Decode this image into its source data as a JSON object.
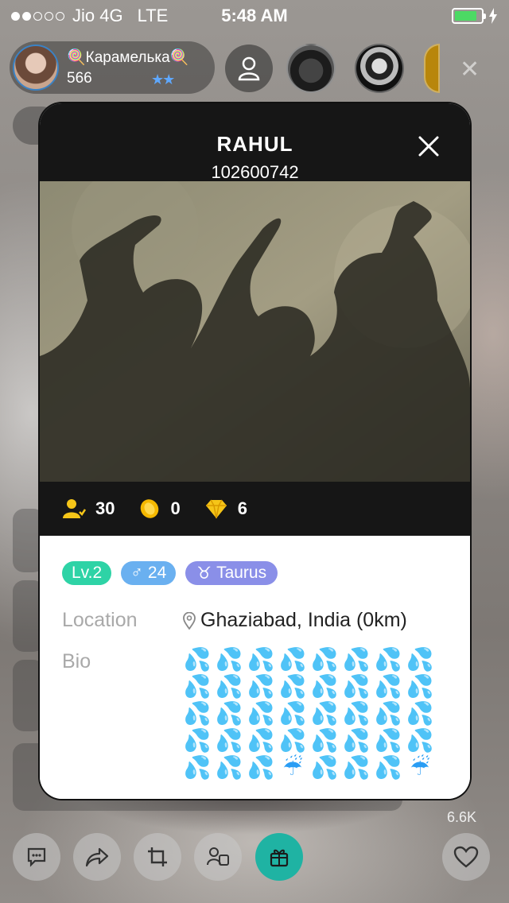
{
  "status_bar": {
    "carrier": "Jio 4G",
    "network": "LTE",
    "time": "5:48 AM",
    "signal_bars_filled": 2,
    "signal_bars_total": 5,
    "battery_level": 0.85,
    "battery_color": "#4cd964"
  },
  "host": {
    "name": "🍭Карамелька🍭",
    "count": "566"
  },
  "heart_count": "6.6K",
  "profile": {
    "name": "RAHUL",
    "id": "102600742",
    "stats": [
      {
        "icon": "followers-icon",
        "value": "30"
      },
      {
        "icon": "coin-icon",
        "value": "0"
      },
      {
        "icon": "diamond-icon",
        "value": "6"
      }
    ],
    "tags": {
      "level": "Lv.2",
      "gender_symbol": "♂",
      "age": "24",
      "zodiac_symbol": "♉",
      "zodiac": "Taurus"
    },
    "location_label": "Location",
    "location_value": "Ghaziabad, India (0km)",
    "bio_label": "Bio",
    "bio": [
      "💦",
      "💦",
      "💦",
      "💦",
      "💦",
      "💦",
      "💦",
      "💦",
      "💦",
      "💦",
      "💦",
      "💦",
      "💦",
      "💦",
      "💦",
      "💦",
      "💦",
      "💦",
      "💦",
      "💦",
      "💦",
      "💦",
      "💦",
      "💦",
      "💦",
      "💦",
      "💦",
      "💦",
      "💦",
      "💦",
      "💦",
      "💦",
      "💦",
      "💦",
      "💦",
      "☔",
      "💦",
      "💦",
      "💦",
      "☔"
    ]
  },
  "colors": {
    "card_dark": "#161616",
    "level_tag": "#2ed3a6",
    "gender_tag": "#6ab0f0",
    "zodiac_tag": "#8a8fe8",
    "gift_button": "#1fb3a3"
  }
}
